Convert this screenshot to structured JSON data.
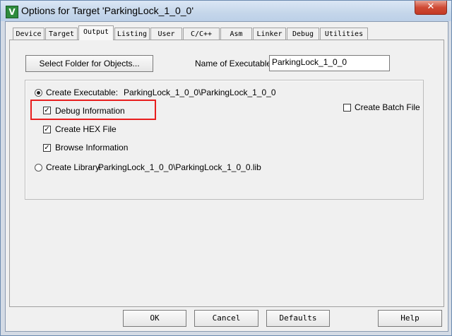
{
  "window": {
    "title": "Options for Target 'ParkingLock_1_0_0'",
    "app_icon_glyph": "V",
    "close_glyph": "✕"
  },
  "tabs": [
    {
      "label": "Device"
    },
    {
      "label": "Target"
    },
    {
      "label": "Output"
    },
    {
      "label": "Listing"
    },
    {
      "label": "User"
    },
    {
      "label": "C/C++"
    },
    {
      "label": "Asm"
    },
    {
      "label": "Linker"
    },
    {
      "label": "Debug"
    },
    {
      "label": "Utilities"
    }
  ],
  "active_tab": "Output",
  "output": {
    "select_folder_label": "Select Folder for Objects...",
    "name_exe_label": "Name of Executable:",
    "name_exe_value": "ParkingLock_1_0_0",
    "create_exe_label": "Create Executable:",
    "create_exe_path": "ParkingLock_1_0_0\\ParkingLock_1_0_0",
    "create_exe_selected": true,
    "debug_info_label": "Debug Information",
    "debug_info_checked": true,
    "create_hex_label": "Create HEX File",
    "create_hex_checked": true,
    "browse_info_label": "Browse Information",
    "browse_info_checked": true,
    "create_batch_label": "Create Batch File",
    "create_batch_checked": false,
    "create_lib_label": "Create Library:",
    "create_lib_path": "ParkingLock_1_0_0\\ParkingLock_1_0_0.lib",
    "create_lib_selected": false,
    "check_glyph": "✓"
  },
  "footer": {
    "ok_label": "OK",
    "cancel_label": "Cancel",
    "defaults_label": "Defaults",
    "help_label": "Help"
  },
  "colors": {
    "highlight_box": "#e81e1e",
    "title_gradient": "#c5d6ea",
    "close_button": "#cf4a35"
  }
}
